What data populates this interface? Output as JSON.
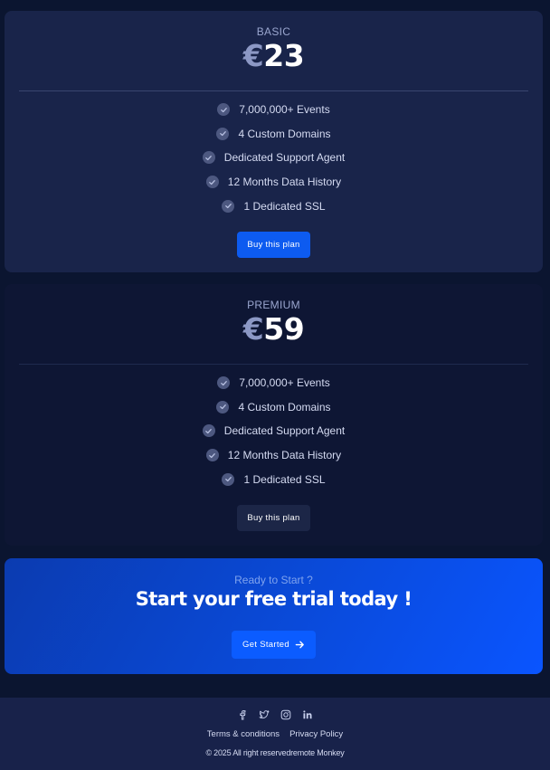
{
  "plans": [
    {
      "name": "BASIC",
      "currency": "€",
      "price": "23",
      "features": [
        "7,000,000+ Events",
        "4 Custom Domains",
        "Dedicated Support Agent",
        "12 Months Data History",
        "1 Dedicated SSL"
      ],
      "button_label": "Buy this plan"
    },
    {
      "name": "PREMIUM",
      "currency": "€",
      "price": "59",
      "features": [
        "7,000,000+ Events",
        "4 Custom Domains",
        "Dedicated Support Agent",
        "12 Months Data History",
        "1 Dedicated SSL"
      ],
      "button_label": "Buy this plan"
    }
  ],
  "cta": {
    "subtitle": "Ready to Start ?",
    "title": "Start your free trial today !",
    "button_label": "Get Started",
    "button_icon": "arrow-right-icon"
  },
  "footer": {
    "social_icons": [
      "facebook-icon",
      "twitter-icon",
      "instagram-icon",
      "linkedin-icon"
    ],
    "links": [
      "Terms & conditions",
      "Privacy Policy"
    ],
    "copyright": "© 2025 All right reservedremote Monkey"
  },
  "colors": {
    "background": "#0b1530",
    "accent": "#0d5bf0",
    "card_highlight": "#19244a"
  }
}
